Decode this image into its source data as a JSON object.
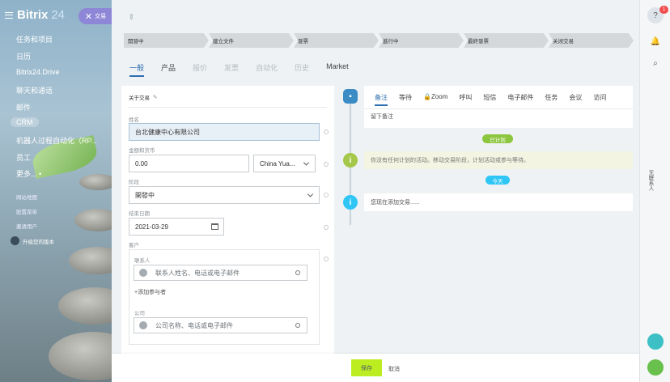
{
  "sidebar": {
    "brand": "Bitrix",
    "brand_num": "24",
    "items": [
      "任务和项目",
      "日历",
      "Bitrix24.Drive",
      "聊天和通话",
      "邮件",
      "CRM",
      "机器人过程自动化（RP...",
      "员工",
      "更多... •"
    ],
    "small_items": [
      "网站地图",
      "配置菜单",
      "邀请用户"
    ],
    "upgrade": "升级您的版本"
  },
  "deal_tab": "交易",
  "stages": [
    "開發中",
    "建立文件",
    "發票",
    "進行中",
    "最終發票",
    "关闭交易"
  ],
  "tabs": [
    "一般",
    "产品",
    "报价",
    "发票",
    "自动化",
    "历史",
    "Market"
  ],
  "form": {
    "title": "关于交易",
    "name_label": "姓名",
    "name_value": "台北健康中心有限公司",
    "amount_label": "金额和货币",
    "amount_value": "0.00",
    "currency_value": "China Yua...",
    "stage_label": "阶段",
    "stage_value": "開發中",
    "close_label": "结束日期",
    "close_value": "2021-03-29",
    "client_label": "客户",
    "contact_label": "联系人",
    "contact_placeholder": "联系人姓名、电话或电子邮件",
    "add_participant": "+添加参与者",
    "company_label": "公司",
    "company_placeholder": "公司名称、电话或电子邮件"
  },
  "timeline": {
    "tabs": [
      "备注",
      "等待",
      "Zoom",
      "呼叫",
      "短信",
      "电子邮件",
      "任务",
      "会议",
      "访问"
    ],
    "note_placeholder": "留下备注",
    "planned_pill": "已计划",
    "planned_text": "你没有任何计划的活动。移动交易阶段，计划活动或参与等待。",
    "today_pill": "今天",
    "created_text": "您现在添加交易......"
  },
  "rail": {
    "badge": "1",
    "vertical_text": "无联系人"
  },
  "footer": {
    "save": "保存",
    "cancel": "取消"
  }
}
